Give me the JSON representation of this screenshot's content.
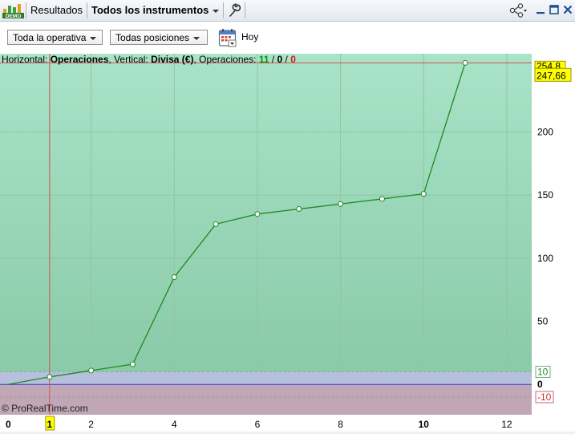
{
  "toolbar": {
    "tab_results": "Resultados",
    "tab_instruments": "Todos los instrumentos",
    "icons": [
      "demo-logo-icon",
      "wrench-icon",
      "share-icon",
      "minimize-icon",
      "maximize-icon",
      "close-icon"
    ]
  },
  "filters": {
    "operativa": "Toda la operativa",
    "posiciones": "Todas posiciones",
    "today": "Hoy"
  },
  "info": {
    "h_label": "Horizontal: ",
    "h_value": "Operaciones",
    "v_label": ", Vertical: ",
    "v_value": "Divisa (€)",
    "ops_label": ", Operaciones: ",
    "ops_total": "11",
    "ops_sep1": " / ",
    "ops_mid": "0",
    "ops_sep2": " / ",
    "ops_losing": "0"
  },
  "copyright": "© ProRealTime.com",
  "colors": {
    "line": "#1e8a1e",
    "crosshair": "#d65050",
    "zero_line": "#2b3fc8",
    "label_bg": "#ffff00"
  },
  "chart_data": {
    "type": "line",
    "x": [
      0,
      1,
      2,
      3,
      4,
      5,
      6,
      7,
      8,
      9,
      10,
      11
    ],
    "y": [
      0,
      6,
      11,
      16,
      85,
      127,
      135,
      139,
      143,
      147,
      151,
      254.8
    ],
    "xlim": [
      0,
      12.6
    ],
    "ylim": [
      -24,
      262
    ],
    "x_ticks": [
      "0",
      "1",
      "2",
      "4",
      "6",
      "8",
      "10",
      "12"
    ],
    "x_tick_values": [
      0,
      1,
      2,
      4,
      6,
      8,
      10,
      12
    ],
    "y_ticks": [
      "50",
      "100",
      "150",
      "200"
    ],
    "y_tick_values": [
      50,
      100,
      150,
      200
    ],
    "band_upper": 10,
    "band_lower": -10,
    "band_upper_label": "10",
    "band_lower_label": "-10",
    "zero_label": "0",
    "last_value_label": "254,8",
    "cursor_value_label": "247,66",
    "cursor_x": 1,
    "cursor_x_label": "1",
    "grid": true
  }
}
